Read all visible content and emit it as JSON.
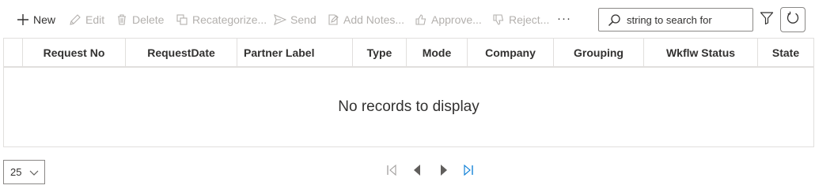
{
  "toolbar": {
    "new_label": "New",
    "edit_label": "Edit",
    "delete_label": "Delete",
    "recategorize_label": "Recategorize...",
    "send_label": "Send",
    "add_notes_label": "Add Notes...",
    "approve_label": "Approve...",
    "reject_label": "Reject...",
    "more_label": "···",
    "search": {
      "value": "string to search for",
      "icon": "search-icon"
    },
    "filter_icon": "filter-icon",
    "refresh_icon": "refresh-icon"
  },
  "grid": {
    "columns": [
      "Request No",
      "RequestDate",
      "Partner Label",
      "Type",
      "Mode",
      "Company",
      "Grouping",
      "Wkflw Status",
      "State"
    ],
    "empty_message": "No records to display"
  },
  "footer": {
    "page_size": "25",
    "pager_icons": [
      "first-page-icon",
      "previous-page-icon",
      "next-page-icon",
      "last-page-icon"
    ]
  },
  "colors": {
    "text": "#323130",
    "disabled": "#b3b0ad",
    "border": "#e1dfdd",
    "accent": "#0078d4"
  }
}
